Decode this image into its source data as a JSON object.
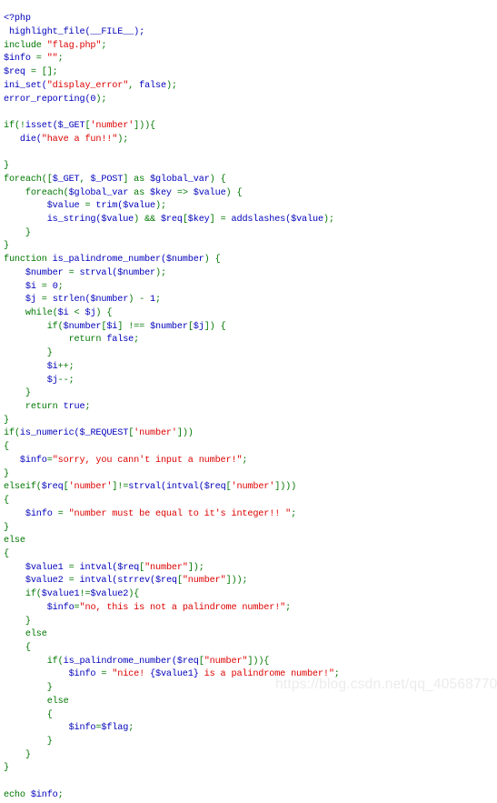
{
  "page": {
    "type": "php-source-listing",
    "background_color": "#ffffff",
    "language": "PHP"
  },
  "palette": {
    "default": "#0000BB",
    "keyword": "#007700",
    "string": "#DD0000",
    "comment": "#FF8000",
    "plain": "#000000",
    "watermark": "#ececec"
  },
  "watermark": {
    "text": "https://blog.csdn.net/qq_40568770"
  },
  "code": {
    "lines": [
      [
        {
          "t": "<?php",
          "c": "d"
        }
      ],
      [
        {
          "t": " highlight_file(__FILE__);",
          "c": "d"
        }
      ],
      [
        {
          "t": "include ",
          "c": "k"
        },
        {
          "t": "\"flag.php\"",
          "c": "s"
        },
        {
          "t": ";",
          "c": "k"
        }
      ],
      [
        {
          "t": "$info ",
          "c": "d"
        },
        {
          "t": "= ",
          "c": "k"
        },
        {
          "t": "\"\"",
          "c": "s"
        },
        {
          "t": ";",
          "c": "k"
        }
      ],
      [
        {
          "t": "$req ",
          "c": "d"
        },
        {
          "t": "= [];",
          "c": "k"
        }
      ],
      [
        {
          "t": "ini_set(",
          "c": "d"
        },
        {
          "t": "\"display_error\"",
          "c": "s"
        },
        {
          "t": ", ",
          "c": "k"
        },
        {
          "t": "false",
          "c": "d"
        },
        {
          "t": ");",
          "c": "k"
        }
      ],
      [
        {
          "t": "error_reporting(",
          "c": "d"
        },
        {
          "t": "0",
          "c": "d"
        },
        {
          "t": ");",
          "c": "k"
        }
      ],
      [
        {
          "t": "",
          "c": "d"
        }
      ],
      [
        {
          "t": "if",
          "c": "k"
        },
        {
          "t": "(!",
          "c": "k"
        },
        {
          "t": "isset(",
          "c": "d"
        },
        {
          "t": "$_GET",
          "c": "d"
        },
        {
          "t": "[",
          "c": "k"
        },
        {
          "t": "'number'",
          "c": "s"
        },
        {
          "t": "])){",
          "c": "k"
        }
      ],
      [
        {
          "t": "   ",
          "c": "k"
        },
        {
          "t": "die(",
          "c": "d"
        },
        {
          "t": "\"have a fun!!\"",
          "c": "s"
        },
        {
          "t": ");",
          "c": "k"
        }
      ],
      [
        {
          "t": "",
          "c": "d"
        }
      ],
      [
        {
          "t": "}",
          "c": "k"
        }
      ],
      [
        {
          "t": "foreach",
          "c": "k"
        },
        {
          "t": "([",
          "c": "k"
        },
        {
          "t": "$_GET",
          "c": "d"
        },
        {
          "t": ", ",
          "c": "k"
        },
        {
          "t": "$_POST",
          "c": "d"
        },
        {
          "t": "] ",
          "c": "k"
        },
        {
          "t": "as ",
          "c": "k"
        },
        {
          "t": "$global_var",
          "c": "d"
        },
        {
          "t": ") {",
          "c": "k"
        }
      ],
      [
        {
          "t": "    ",
          "c": "k"
        },
        {
          "t": "foreach",
          "c": "k"
        },
        {
          "t": "(",
          "c": "k"
        },
        {
          "t": "$global_var ",
          "c": "d"
        },
        {
          "t": "as ",
          "c": "k"
        },
        {
          "t": "$key ",
          "c": "d"
        },
        {
          "t": "=> ",
          "c": "k"
        },
        {
          "t": "$value",
          "c": "d"
        },
        {
          "t": ") {",
          "c": "k"
        }
      ],
      [
        {
          "t": "        ",
          "c": "k"
        },
        {
          "t": "$value ",
          "c": "d"
        },
        {
          "t": "= ",
          "c": "k"
        },
        {
          "t": "trim(",
          "c": "d"
        },
        {
          "t": "$value",
          "c": "d"
        },
        {
          "t": ");",
          "c": "k"
        }
      ],
      [
        {
          "t": "        ",
          "c": "k"
        },
        {
          "t": "is_string(",
          "c": "d"
        },
        {
          "t": "$value",
          "c": "d"
        },
        {
          "t": ") ",
          "c": "k"
        },
        {
          "t": "&& ",
          "c": "k"
        },
        {
          "t": "$req",
          "c": "d"
        },
        {
          "t": "[",
          "c": "k"
        },
        {
          "t": "$key",
          "c": "d"
        },
        {
          "t": "] = ",
          "c": "k"
        },
        {
          "t": "addslashes(",
          "c": "d"
        },
        {
          "t": "$value",
          "c": "d"
        },
        {
          "t": ");",
          "c": "k"
        }
      ],
      [
        {
          "t": "    }",
          "c": "k"
        }
      ],
      [
        {
          "t": "}",
          "c": "k"
        }
      ],
      [
        {
          "t": "function ",
          "c": "k"
        },
        {
          "t": "is_palindrome_number(",
          "c": "d"
        },
        {
          "t": "$number",
          "c": "d"
        },
        {
          "t": ") {",
          "c": "k"
        }
      ],
      [
        {
          "t": "    ",
          "c": "k"
        },
        {
          "t": "$number ",
          "c": "d"
        },
        {
          "t": "= ",
          "c": "k"
        },
        {
          "t": "strval(",
          "c": "d"
        },
        {
          "t": "$number",
          "c": "d"
        },
        {
          "t": ");",
          "c": "k"
        }
      ],
      [
        {
          "t": "    ",
          "c": "k"
        },
        {
          "t": "$i ",
          "c": "d"
        },
        {
          "t": "= ",
          "c": "k"
        },
        {
          "t": "0",
          "c": "d"
        },
        {
          "t": ";",
          "c": "k"
        }
      ],
      [
        {
          "t": "    ",
          "c": "k"
        },
        {
          "t": "$j ",
          "c": "d"
        },
        {
          "t": "= ",
          "c": "k"
        },
        {
          "t": "strlen(",
          "c": "d"
        },
        {
          "t": "$number",
          "c": "d"
        },
        {
          "t": ") - ",
          "c": "k"
        },
        {
          "t": "1",
          "c": "d"
        },
        {
          "t": ";",
          "c": "k"
        }
      ],
      [
        {
          "t": "    ",
          "c": "k"
        },
        {
          "t": "while",
          "c": "k"
        },
        {
          "t": "(",
          "c": "k"
        },
        {
          "t": "$i ",
          "c": "d"
        },
        {
          "t": "< ",
          "c": "k"
        },
        {
          "t": "$j",
          "c": "d"
        },
        {
          "t": ") {",
          "c": "k"
        }
      ],
      [
        {
          "t": "        ",
          "c": "k"
        },
        {
          "t": "if",
          "c": "k"
        },
        {
          "t": "(",
          "c": "k"
        },
        {
          "t": "$number",
          "c": "d"
        },
        {
          "t": "[",
          "c": "k"
        },
        {
          "t": "$i",
          "c": "d"
        },
        {
          "t": "] !== ",
          "c": "k"
        },
        {
          "t": "$number",
          "c": "d"
        },
        {
          "t": "[",
          "c": "k"
        },
        {
          "t": "$j",
          "c": "d"
        },
        {
          "t": "]) {",
          "c": "k"
        }
      ],
      [
        {
          "t": "            ",
          "c": "k"
        },
        {
          "t": "return ",
          "c": "k"
        },
        {
          "t": "false",
          "c": "d"
        },
        {
          "t": ";",
          "c": "k"
        }
      ],
      [
        {
          "t": "        }",
          "c": "k"
        }
      ],
      [
        {
          "t": "        ",
          "c": "k"
        },
        {
          "t": "$i",
          "c": "d"
        },
        {
          "t": "++;",
          "c": "k"
        }
      ],
      [
        {
          "t": "        ",
          "c": "k"
        },
        {
          "t": "$j",
          "c": "d"
        },
        {
          "t": "--;",
          "c": "k"
        }
      ],
      [
        {
          "t": "    }",
          "c": "k"
        }
      ],
      [
        {
          "t": "    ",
          "c": "k"
        },
        {
          "t": "return ",
          "c": "k"
        },
        {
          "t": "true",
          "c": "d"
        },
        {
          "t": ";",
          "c": "k"
        }
      ],
      [
        {
          "t": "}",
          "c": "k"
        }
      ],
      [
        {
          "t": "if",
          "c": "k"
        },
        {
          "t": "(",
          "c": "k"
        },
        {
          "t": "is_numeric(",
          "c": "d"
        },
        {
          "t": "$_REQUEST",
          "c": "d"
        },
        {
          "t": "[",
          "c": "k"
        },
        {
          "t": "'number'",
          "c": "s"
        },
        {
          "t": "]))",
          "c": "k"
        }
      ],
      [
        {
          "t": "{",
          "c": "k"
        }
      ],
      [
        {
          "t": "   ",
          "c": "k"
        },
        {
          "t": "$info",
          "c": "d"
        },
        {
          "t": "=",
          "c": "k"
        },
        {
          "t": "\"sorry, you cann't input a number!\"",
          "c": "s"
        },
        {
          "t": ";",
          "c": "k"
        }
      ],
      [
        {
          "t": "}",
          "c": "k"
        }
      ],
      [
        {
          "t": "elseif",
          "c": "k"
        },
        {
          "t": "(",
          "c": "k"
        },
        {
          "t": "$req",
          "c": "d"
        },
        {
          "t": "[",
          "c": "k"
        },
        {
          "t": "'number'",
          "c": "s"
        },
        {
          "t": "]!=",
          "c": "k"
        },
        {
          "t": "strval(",
          "c": "d"
        },
        {
          "t": "intval(",
          "c": "d"
        },
        {
          "t": "$req",
          "c": "d"
        },
        {
          "t": "[",
          "c": "k"
        },
        {
          "t": "'number'",
          "c": "s"
        },
        {
          "t": "])))",
          "c": "k"
        }
      ],
      [
        {
          "t": "{",
          "c": "k"
        }
      ],
      [
        {
          "t": "    ",
          "c": "k"
        },
        {
          "t": "$info ",
          "c": "d"
        },
        {
          "t": "= ",
          "c": "k"
        },
        {
          "t": "\"number must be equal to it's integer!! \"",
          "c": "s"
        },
        {
          "t": ";",
          "c": "k"
        }
      ],
      [
        {
          "t": "}",
          "c": "k"
        }
      ],
      [
        {
          "t": "else",
          "c": "k"
        }
      ],
      [
        {
          "t": "{",
          "c": "k"
        }
      ],
      [
        {
          "t": "    ",
          "c": "k"
        },
        {
          "t": "$value1 ",
          "c": "d"
        },
        {
          "t": "= ",
          "c": "k"
        },
        {
          "t": "intval(",
          "c": "d"
        },
        {
          "t": "$req",
          "c": "d"
        },
        {
          "t": "[",
          "c": "k"
        },
        {
          "t": "\"number\"",
          "c": "s"
        },
        {
          "t": "]);",
          "c": "k"
        }
      ],
      [
        {
          "t": "    ",
          "c": "k"
        },
        {
          "t": "$value2 ",
          "c": "d"
        },
        {
          "t": "= ",
          "c": "k"
        },
        {
          "t": "intval(",
          "c": "d"
        },
        {
          "t": "strrev(",
          "c": "d"
        },
        {
          "t": "$req",
          "c": "d"
        },
        {
          "t": "[",
          "c": "k"
        },
        {
          "t": "\"number\"",
          "c": "s"
        },
        {
          "t": "]));",
          "c": "k"
        }
      ],
      [
        {
          "t": "    ",
          "c": "k"
        },
        {
          "t": "if",
          "c": "k"
        },
        {
          "t": "(",
          "c": "k"
        },
        {
          "t": "$value1",
          "c": "d"
        },
        {
          "t": "!=",
          "c": "k"
        },
        {
          "t": "$value2",
          "c": "d"
        },
        {
          "t": "){",
          "c": "k"
        }
      ],
      [
        {
          "t": "        ",
          "c": "k"
        },
        {
          "t": "$info",
          "c": "d"
        },
        {
          "t": "=",
          "c": "k"
        },
        {
          "t": "\"no, this is not a palindrome number!\"",
          "c": "s"
        },
        {
          "t": ";",
          "c": "k"
        }
      ],
      [
        {
          "t": "    }",
          "c": "k"
        }
      ],
      [
        {
          "t": "    ",
          "c": "k"
        },
        {
          "t": "else",
          "c": "k"
        }
      ],
      [
        {
          "t": "    {",
          "c": "k"
        }
      ],
      [
        {
          "t": "        ",
          "c": "k"
        },
        {
          "t": "if",
          "c": "k"
        },
        {
          "t": "(",
          "c": "k"
        },
        {
          "t": "is_palindrome_number(",
          "c": "d"
        },
        {
          "t": "$req",
          "c": "d"
        },
        {
          "t": "[",
          "c": "k"
        },
        {
          "t": "\"number\"",
          "c": "s"
        },
        {
          "t": "])){",
          "c": "k"
        }
      ],
      [
        {
          "t": "            ",
          "c": "k"
        },
        {
          "t": "$info ",
          "c": "d"
        },
        {
          "t": "= ",
          "c": "k"
        },
        {
          "t": "\"nice! ",
          "c": "s"
        },
        {
          "t": "{$value1}",
          "c": "d"
        },
        {
          "t": " is a palindrome number!\"",
          "c": "s"
        },
        {
          "t": ";",
          "c": "k"
        }
      ],
      [
        {
          "t": "        }",
          "c": "k"
        }
      ],
      [
        {
          "t": "        ",
          "c": "k"
        },
        {
          "t": "else",
          "c": "k"
        }
      ],
      [
        {
          "t": "        {",
          "c": "k"
        }
      ],
      [
        {
          "t": "            ",
          "c": "k"
        },
        {
          "t": "$info",
          "c": "d"
        },
        {
          "t": "=",
          "c": "k"
        },
        {
          "t": "$flag",
          "c": "d"
        },
        {
          "t": ";",
          "c": "k"
        }
      ],
      [
        {
          "t": "        }",
          "c": "k"
        }
      ],
      [
        {
          "t": "    }",
          "c": "k"
        }
      ],
      [
        {
          "t": "}",
          "c": "k"
        }
      ],
      [
        {
          "t": "",
          "c": "d"
        }
      ],
      [
        {
          "t": "echo ",
          "c": "k"
        },
        {
          "t": "$info",
          "c": "d"
        },
        {
          "t": ";",
          "c": "k"
        }
      ]
    ]
  }
}
